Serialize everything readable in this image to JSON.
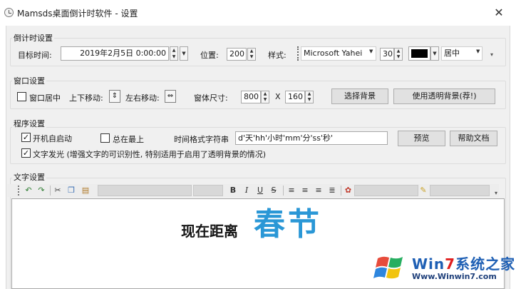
{
  "window": {
    "title": "Mamsds桌面倒计时软件 - 设置",
    "close_glyph": "✕"
  },
  "countdown_settings": {
    "group_title": "倒计时设置",
    "target_time_label": "目标时间:",
    "target_time_value": "2019年2月5日 0:00:00",
    "position_label": "位置:",
    "position_value": "200",
    "style_label": "样式:",
    "font_name": "Microsoft Yahei",
    "font_size": "30",
    "text_color": "#000000",
    "align_value": "居中"
  },
  "window_settings": {
    "group_title": "窗口设置",
    "center_window_label": "窗口居中",
    "center_window_checked": false,
    "move_vertical_label": "上下移动:",
    "move_horizontal_label": "左右移动:",
    "size_label": "窗体尺寸:",
    "width_value": "800",
    "times_label": "X",
    "height_value": "160",
    "choose_bg_button": "选择背景",
    "transparent_bg_button": "使用透明背景(荐!)"
  },
  "program_settings": {
    "group_title": "程序设置",
    "autostart_label": "开机自启动",
    "autostart_checked": true,
    "topmost_label": "总在最上",
    "topmost_checked": false,
    "time_format_label": "时间格式字符串",
    "time_format_value": "d'天'hh'小时'mm'分'ss'秒'",
    "preview_button": "预览",
    "help_button": "帮助文档",
    "glow_label": "文字发光 (增强文字的可识别性, 特别适用于启用了透明背景的情况)",
    "glow_checked": true
  },
  "text_settings": {
    "group_title": "文字设置",
    "toolbar": {
      "bold": "B",
      "italic": "I",
      "underline": "U",
      "strike": "S"
    },
    "preview_text_left": "现在距离",
    "preview_text_right": "春节"
  },
  "watermark": {
    "brand_prefix": "Win",
    "brand_number": "7",
    "brand_suffix": "系统之家",
    "url": "Www.Winwin7.com"
  }
}
